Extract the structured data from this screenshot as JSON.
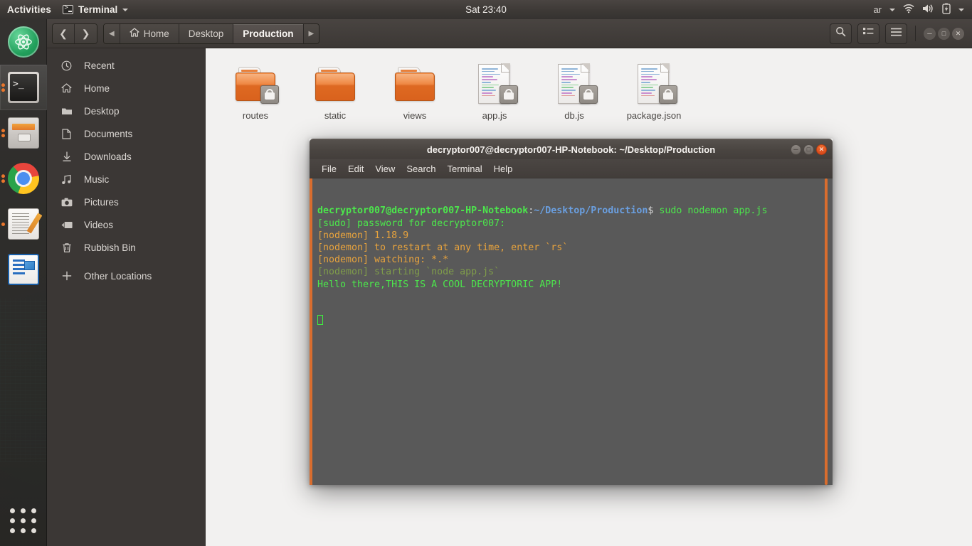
{
  "topbar": {
    "activities": "Activities",
    "app_menu": "Terminal",
    "app_icon": "terminal-icon",
    "clock": "Sat 23:40",
    "language": "ar",
    "indicators": [
      "wifi-icon",
      "volume-icon",
      "battery-icon",
      "system-menu-caret-icon"
    ]
  },
  "launcher": {
    "items": [
      {
        "name": "atom",
        "icon": "atom-icon",
        "running": false,
        "active": false
      },
      {
        "name": "terminal",
        "icon": "terminal-icon",
        "running": true,
        "active": true
      },
      {
        "name": "files",
        "icon": "file-manager-icon",
        "running": true,
        "active": false
      },
      {
        "name": "chrome",
        "icon": "chrome-icon",
        "running": true,
        "active": false
      },
      {
        "name": "text-editor",
        "icon": "text-editor-icon",
        "running": true,
        "active": false
      },
      {
        "name": "impress",
        "icon": "libreoffice-impress-icon",
        "running": false,
        "active": false
      }
    ],
    "show_applications": "app-grid-icon"
  },
  "file_manager": {
    "nav": {
      "back": "back-icon",
      "forward": "forward-icon"
    },
    "breadcrumbs": [
      {
        "label": "Home",
        "icon": "home-icon",
        "current": false
      },
      {
        "label": "Desktop",
        "icon": "",
        "current": false
      },
      {
        "label": "Production",
        "icon": "",
        "current": true
      }
    ],
    "toolbar": {
      "search": "search-icon",
      "view_toggle": "list-view-icon",
      "menu": "hamburger-menu-icon"
    },
    "window_controls": [
      "minimize",
      "maximize",
      "close"
    ],
    "sidebar": [
      {
        "label": "Recent",
        "icon": "clock-icon"
      },
      {
        "label": "Home",
        "icon": "home-icon"
      },
      {
        "label": "Desktop",
        "icon": "folder-icon"
      },
      {
        "label": "Documents",
        "icon": "document-icon"
      },
      {
        "label": "Downloads",
        "icon": "download-icon"
      },
      {
        "label": "Music",
        "icon": "music-icon"
      },
      {
        "label": "Pictures",
        "icon": "camera-icon"
      },
      {
        "label": "Videos",
        "icon": "video-icon"
      },
      {
        "label": "Rubbish Bin",
        "icon": "trash-icon"
      },
      {
        "label": "Other Locations",
        "icon": "plus-icon"
      }
    ],
    "files": [
      {
        "name": "routes",
        "type": "folder",
        "locked": true
      },
      {
        "name": "static",
        "type": "folder",
        "locked": false
      },
      {
        "name": "views",
        "type": "folder",
        "locked": false
      },
      {
        "name": "app.js",
        "type": "file",
        "locked": true
      },
      {
        "name": "db.js",
        "type": "file",
        "locked": true
      },
      {
        "name": "package.json",
        "type": "file",
        "locked": true
      }
    ]
  },
  "terminal": {
    "title": "decryptor007@decryptor007-HP-Notebook: ~/Desktop/Production",
    "menu": [
      "File",
      "Edit",
      "View",
      "Search",
      "Terminal",
      "Help"
    ],
    "window_controls": [
      "minimize",
      "maximize",
      "close"
    ],
    "lines": [
      {
        "segments": [
          {
            "text": "decryptor007@decryptor007-HP-Notebook",
            "color": "#4ce64c",
            "bold": true
          },
          {
            "text": ":",
            "color": "#d8d8d8",
            "bold": false
          },
          {
            "text": "~/Desktop/Production",
            "color": "#6a9fe0",
            "bold": true
          },
          {
            "text": "$ ",
            "color": "#d8d8d8",
            "bold": false
          },
          {
            "text": "sudo nodemon app.js",
            "color": "#4ce64c",
            "bold": false
          }
        ]
      },
      {
        "segments": [
          {
            "text": "[sudo] password for decryptor007:",
            "color": "#4ce64c",
            "bold": false
          }
        ]
      },
      {
        "segments": [
          {
            "text": "[nodemon] 1.18.9",
            "color": "#e8a33d",
            "bold": false
          }
        ]
      },
      {
        "segments": [
          {
            "text": "[nodemon] to restart at any time, enter `rs`",
            "color": "#e8a33d",
            "bold": false
          }
        ]
      },
      {
        "segments": [
          {
            "text": "[nodemon] watching: *.*",
            "color": "#e8a33d",
            "bold": false
          }
        ]
      },
      {
        "segments": [
          {
            "text": "[nodemon] starting `node app.js`",
            "color": "#7f9c4a",
            "bold": false
          }
        ]
      },
      {
        "segments": [
          {
            "text": "Hello there,THIS IS A COOL DECRYPTORIC APP!",
            "color": "#4ce64c",
            "bold": false
          }
        ]
      }
    ],
    "cursor": true,
    "accent_color": "#d96d2e",
    "background_color": "#595959"
  }
}
